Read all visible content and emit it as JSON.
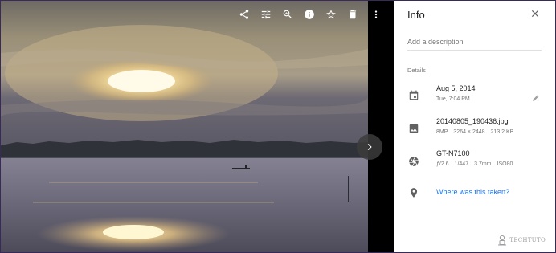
{
  "viewer": {
    "toolbar": {
      "icons": [
        "share-icon",
        "tune-icon",
        "zoom-in-icon",
        "info-icon",
        "star-icon",
        "delete-icon"
      ],
      "more_icon": "more-vert-icon"
    },
    "next_icon": "chevron-right-icon"
  },
  "panel": {
    "title": "Info",
    "close_icon": "close-icon",
    "description_placeholder": "Add a description",
    "details_label": "Details",
    "date": {
      "icon": "calendar-icon",
      "primary": "Aug 5, 2014",
      "secondary": "Tue, 7:04 PM",
      "edit_icon": "pencil-icon"
    },
    "file": {
      "icon": "image-icon",
      "primary": "20140805_190436.jpg",
      "megapixels": "8MP",
      "dimensions": "3264 × 2448",
      "size": "213.2 KB"
    },
    "camera": {
      "icon": "camera-aperture-icon",
      "primary": "GT-N7100",
      "aperture": "ƒ/2.6",
      "shutter": "1/447",
      "focal": "3.7mm",
      "iso": "ISO80"
    },
    "location": {
      "icon": "location-pin-icon",
      "link": "Where was this taken?"
    }
  },
  "watermark": {
    "text": "TECHTUTO"
  },
  "colors": {
    "accent": "#1a73e8",
    "panel_bg": "#ffffff",
    "viewer_bg": "#000000"
  }
}
